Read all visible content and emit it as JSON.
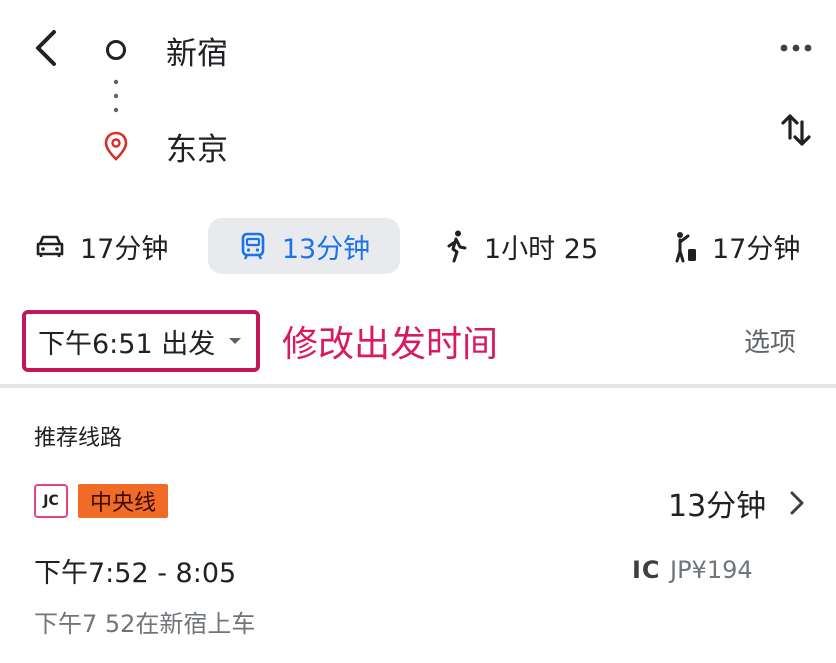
{
  "header": {
    "origin": "新宿",
    "destination": "东京"
  },
  "modes": {
    "driving": "17分钟",
    "transit": "13分钟",
    "walking": "1小时 25",
    "ride": "17分钟"
  },
  "departure": {
    "label": "下午6:51 出发",
    "annotation": "修改出发时间",
    "options": "选项"
  },
  "route": {
    "section_title": "推荐线路",
    "operator_badge": "JC",
    "line_name": "中央线",
    "duration": "13分钟",
    "time_range": "下午7:52 - 8:05",
    "payment_label": "IC",
    "fare": "JP¥194",
    "boarding": "下午7 52在新宿上车"
  },
  "colors": {
    "accent": "#1a73e8",
    "highlight": "#c2185b",
    "line_badge": "#f06a28"
  }
}
